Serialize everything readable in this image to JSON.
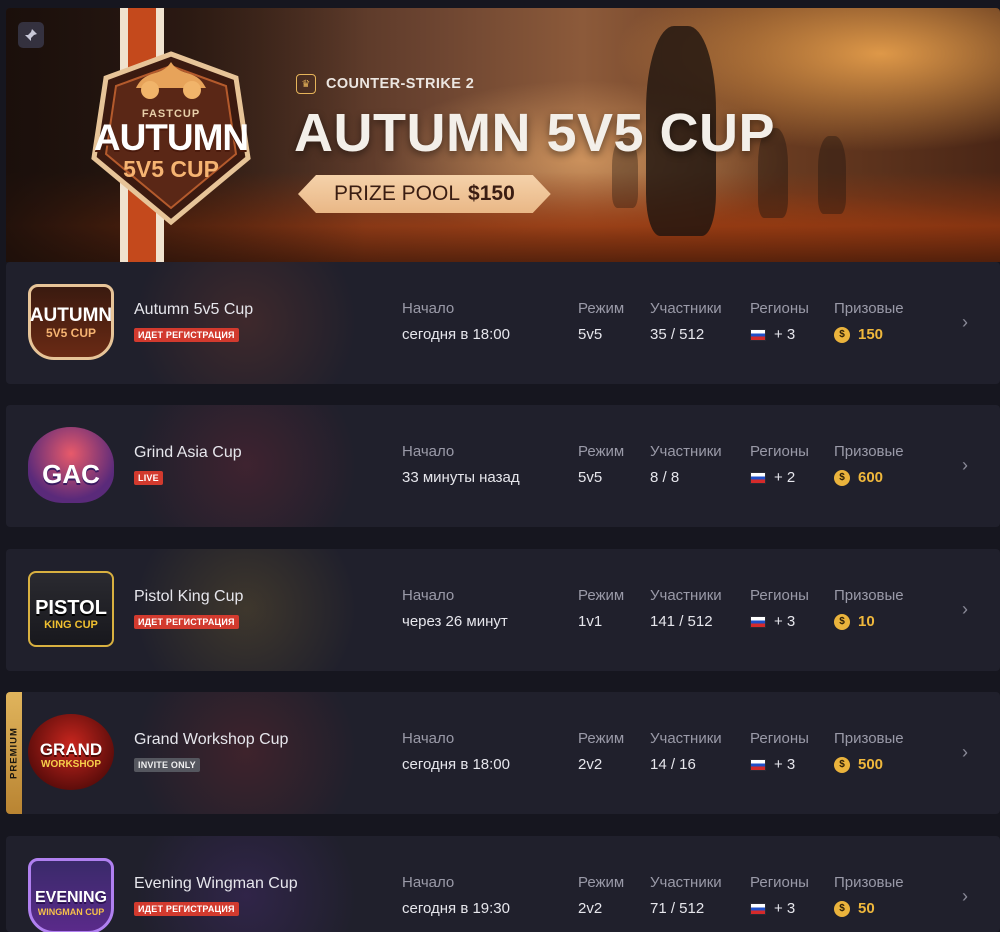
{
  "banner": {
    "pin_icon": "pin-icon",
    "crest": {
      "small": "FASTCUP",
      "big": "AUTUMN",
      "sub": "5V5 CUP"
    },
    "game": "COUNTER-STRIKE 2",
    "title": "AUTUMN 5V5 CUP",
    "prize_label": "PRIZE POOL",
    "prize_value": "$150"
  },
  "labels": {
    "start": "Начало",
    "mode": "Режим",
    "participants": "Участники",
    "regions": "Регионы",
    "prizes": "Призовые",
    "premium": "PREMIUM"
  },
  "tournaments": [
    {
      "name": "Autumn 5v5 Cup",
      "badge": "ИДЕТ РЕГИСТРАЦИЯ",
      "start": "сегодня в 18:00",
      "mode": "5v5",
      "participants": "35 / 512",
      "regions": "+ 3",
      "prize": "150",
      "logo_top": "AUTUMN",
      "logo_bottom": "5V5 CUP"
    },
    {
      "name": "Grind Asia Cup",
      "badge": "LIVE",
      "start": "33 минуты назад",
      "mode": "5v5",
      "participants": "8 / 8",
      "regions": "+ 2",
      "prize": "600",
      "logo_top": "GAC",
      "logo_bottom": ""
    },
    {
      "name": "Pistol King Cup",
      "badge": "ИДЕТ РЕГИСТРАЦИЯ",
      "start": "через 26 минут",
      "mode": "1v1",
      "participants": "141 / 512",
      "regions": "+ 3",
      "prize": "10",
      "logo_top": "PISTOL",
      "logo_bottom": "KING CUP"
    },
    {
      "name": "Grand Workshop Cup",
      "badge": "INVITE ONLY",
      "start": "сегодня в 18:00",
      "mode": "2v2",
      "participants": "14 / 16",
      "regions": "+ 3",
      "prize": "500",
      "logo_top": "GRAND",
      "logo_bottom": "WORKSHOP"
    },
    {
      "name": "Evening Wingman Cup",
      "badge": "ИДЕТ РЕГИСТРАЦИЯ",
      "start": "сегодня в 19:30",
      "mode": "2v2",
      "participants": "71 / 512",
      "regions": "+ 3",
      "prize": "50",
      "logo_top": "EVENING",
      "logo_bottom": "WINGMAN CUP"
    }
  ],
  "coin_symbol": "$",
  "chevron": "›",
  "colors": {
    "accent_orange": "#e9b786",
    "badge_red": "#d23a2e",
    "coin_gold": "#eab33c",
    "premium_gold": "#e0b45c"
  }
}
